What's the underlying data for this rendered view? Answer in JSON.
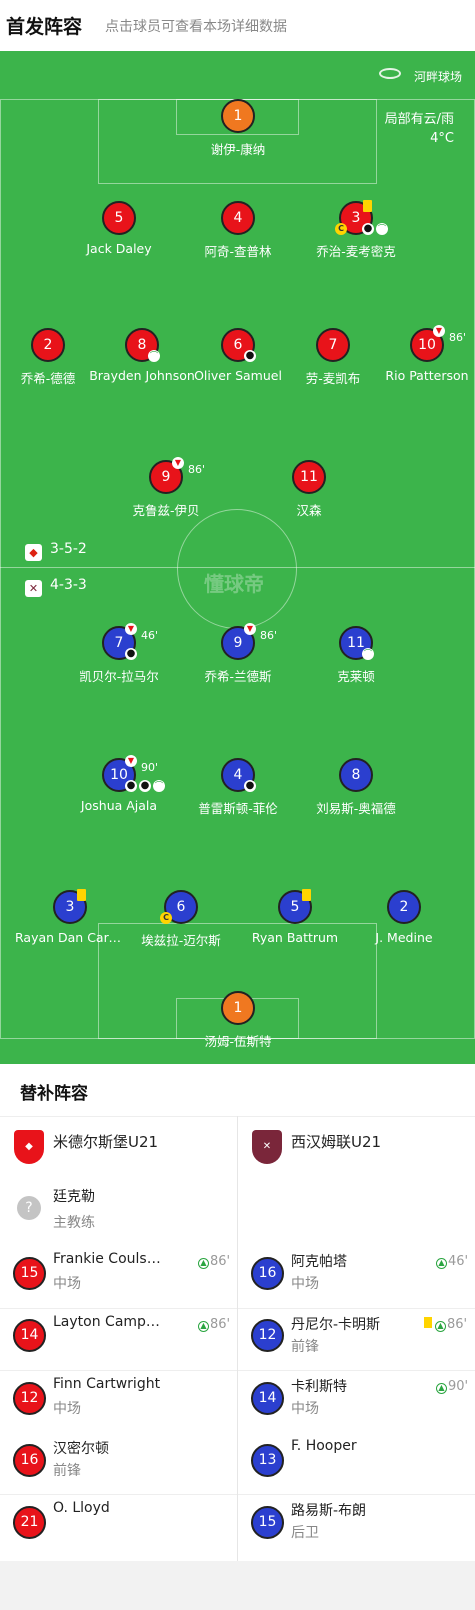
{
  "header": {
    "title": "首发阵容",
    "subtitle": "点击球员可查看本场详细数据"
  },
  "pitch": {
    "venue": "河畔球场",
    "weather": "局部有云/雨",
    "temperature": "4°C",
    "watermark": "懂球帝",
    "home_formation": "3-5-2",
    "away_formation": "4-3-3"
  },
  "home_lineup": [
    {
      "number": "1",
      "name": "谢伊-康纳",
      "role": "goalkeeper"
    },
    {
      "number": "5",
      "name": "Jack Daley"
    },
    {
      "number": "4",
      "name": "阿奇-查普林"
    },
    {
      "number": "3",
      "name": "乔治-麦考密克",
      "yellow_card": true,
      "captain": "C",
      "goal": true,
      "assist": true
    },
    {
      "number": "2",
      "name": "乔希-德德"
    },
    {
      "number": "8",
      "name": "Brayden Johnson",
      "assist": true
    },
    {
      "number": "6",
      "name": "Oliver Samuel",
      "goal": true
    },
    {
      "number": "7",
      "name": "劳-麦凯布"
    },
    {
      "number": "10",
      "name": "Rio Patterson",
      "sub_off_minute": "86'"
    },
    {
      "number": "9",
      "name": "克鲁兹-伊贝",
      "sub_off_minute": "86'"
    },
    {
      "number": "11",
      "name": "汉森"
    }
  ],
  "away_lineup": [
    {
      "number": "7",
      "name": "凯贝尔-拉马尔",
      "sub_off_minute": "46'",
      "goal": true
    },
    {
      "number": "9",
      "name": "乔希-兰德斯",
      "sub_off_minute": "86'"
    },
    {
      "number": "11",
      "name": "克莱顿",
      "assist": true
    },
    {
      "number": "10",
      "name": "Joshua Ajala",
      "sub_off_minute": "90'",
      "goals": 2,
      "assist": true
    },
    {
      "number": "4",
      "name": "普雷斯顿-菲伦",
      "goal": true
    },
    {
      "number": "8",
      "name": "刘易斯-奥福德"
    },
    {
      "number": "3",
      "name": "Rayan Dan Cardoso",
      "yellow_card": true
    },
    {
      "number": "6",
      "name": "埃兹拉-迈尔斯",
      "captain": "C"
    },
    {
      "number": "5",
      "name": "Ryan Battrum",
      "yellow_card": true
    },
    {
      "number": "2",
      "name": "J. Medine"
    },
    {
      "number": "1",
      "name": "汤姆-伍斯特",
      "role": "goalkeeper"
    }
  ],
  "subs": {
    "title": "替补阵容",
    "home_team": "米德尔斯堡U21",
    "away_team": "西汉姆联U21",
    "home_coach": {
      "name": "廷克勒",
      "role": "主教练"
    },
    "home": [
      {
        "number": "15",
        "name": "Frankie Coulson",
        "position": "中场",
        "sub_on_minute": "86'"
      },
      {
        "number": "14",
        "name": "Layton Campbell",
        "position": "",
        "sub_on_minute": "86'"
      },
      {
        "number": "12",
        "name": "Finn Cartwright",
        "position": "中场",
        "sub_on_minute": ""
      },
      {
        "number": "16",
        "name": "汉密尔顿",
        "position": "前锋",
        "sub_on_minute": ""
      },
      {
        "number": "21",
        "name": "O. Lloyd",
        "position": "",
        "sub_on_minute": ""
      }
    ],
    "away": [
      {
        "number": "16",
        "name": "阿克帕塔",
        "position": "中场",
        "sub_on_minute": "46'"
      },
      {
        "number": "12",
        "name": "丹尼尔-卡明斯",
        "position": "前锋",
        "sub_on_minute": "86'",
        "yellow_card": true
      },
      {
        "number": "14",
        "name": "卡利斯特",
        "position": "中场",
        "sub_on_minute": "90'"
      },
      {
        "number": "13",
        "name": "F. Hooper",
        "position": "",
        "sub_on_minute": ""
      },
      {
        "number": "15",
        "name": "路易斯-布朗",
        "position": "后卫",
        "sub_on_minute": ""
      }
    ]
  },
  "colors": {
    "pitch": "#3cb44b",
    "home": "#e8131a",
    "away": "#2b3fcf",
    "goalkeeper": "#f07820",
    "card": "#ffd400"
  }
}
